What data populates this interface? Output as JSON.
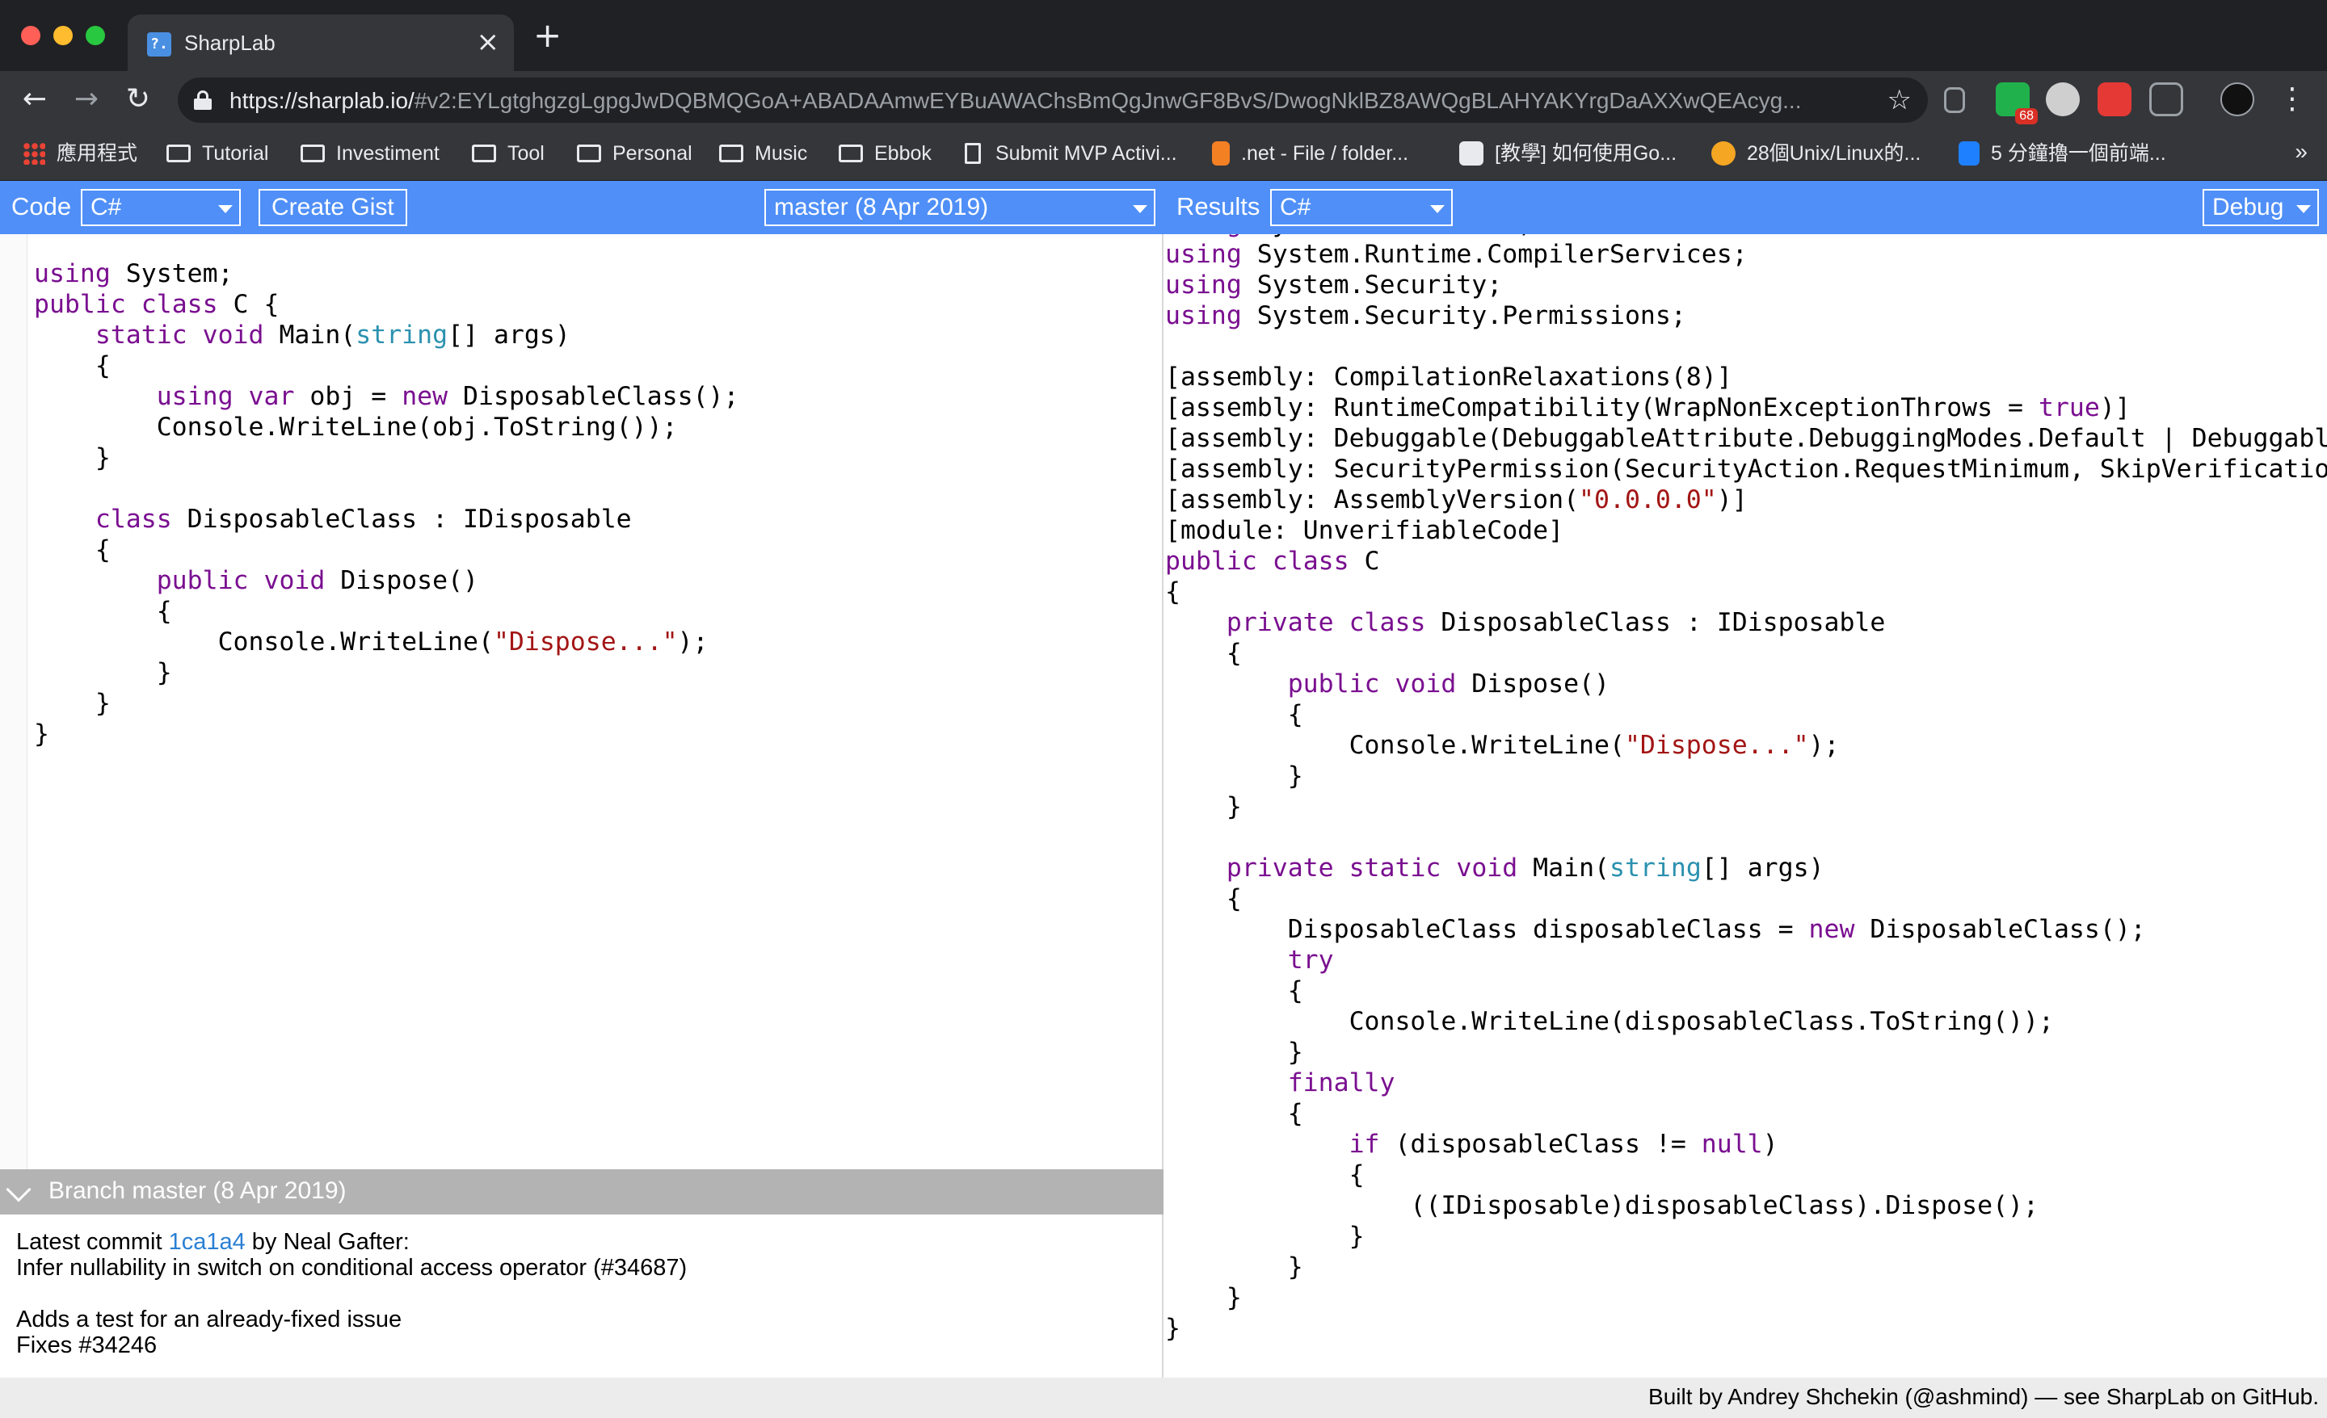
{
  "browser": {
    "tab": {
      "title": "SharpLab",
      "favicon_text": "?."
    },
    "url": {
      "host": "https://sharplab.io/",
      "path": "#v2:EYLgtghgzgLgpgJwDQBMQGoA+ABADAAmwEYBuAWAChsBmQgJnwGF8BvS/DwogNklBZ8AWQgBLAHYAKYrgDaAXXwQEAcyg..."
    },
    "bookmarks": [
      {
        "label": "應用程式",
        "icon": "apps-grid-icon"
      },
      {
        "label": "Tutorial",
        "icon": "folder-icon"
      },
      {
        "label": "Investiment",
        "icon": "folder-icon"
      },
      {
        "label": "Tool",
        "icon": "folder-icon"
      },
      {
        "label": "Personal",
        "icon": "folder-icon"
      },
      {
        "label": "Music",
        "icon": "folder-icon"
      },
      {
        "label": "Ebbok",
        "icon": "folder-icon"
      },
      {
        "label": "Submit MVP Activi...",
        "icon": "page-icon"
      },
      {
        "label": ".net - File / folder...",
        "icon": "stackoverflow-icon"
      },
      {
        "label": "[教學] 如何使用Go...",
        "icon": "site-favicon"
      },
      {
        "label": "28個Unix/Linux的...",
        "icon": "site-favicon"
      },
      {
        "label": "5 分鐘擼一個前端...",
        "icon": "site-favicon"
      }
    ],
    "extension_badge": "68",
    "overflow": "»"
  },
  "app": {
    "code_label": "Code",
    "code_language": "C#",
    "create_gist": "Create Gist",
    "branch_select": "master (8 Apr 2019)",
    "results_label": "Results",
    "results_language": "C#",
    "mode": "Debug",
    "branch_bar": "Branch master (8 Apr 2019)",
    "commit": {
      "prefix": "Latest commit ",
      "hash": "1ca1a4",
      "author": " by Neal Gafter:",
      "title": "Infer nullability in switch on conditional access operator (#34687)",
      "body1": "Adds a test for an already-fixed issue",
      "body2": "Fixes #34246"
    },
    "footer": "Built by Andrey Shchekin (@ashmind) — see SharpLab on GitHub."
  },
  "colors": {
    "accent": "#4f8ff7",
    "keyword": "#7a0f90",
    "type": "#2b91af",
    "string": "#a31515"
  }
}
